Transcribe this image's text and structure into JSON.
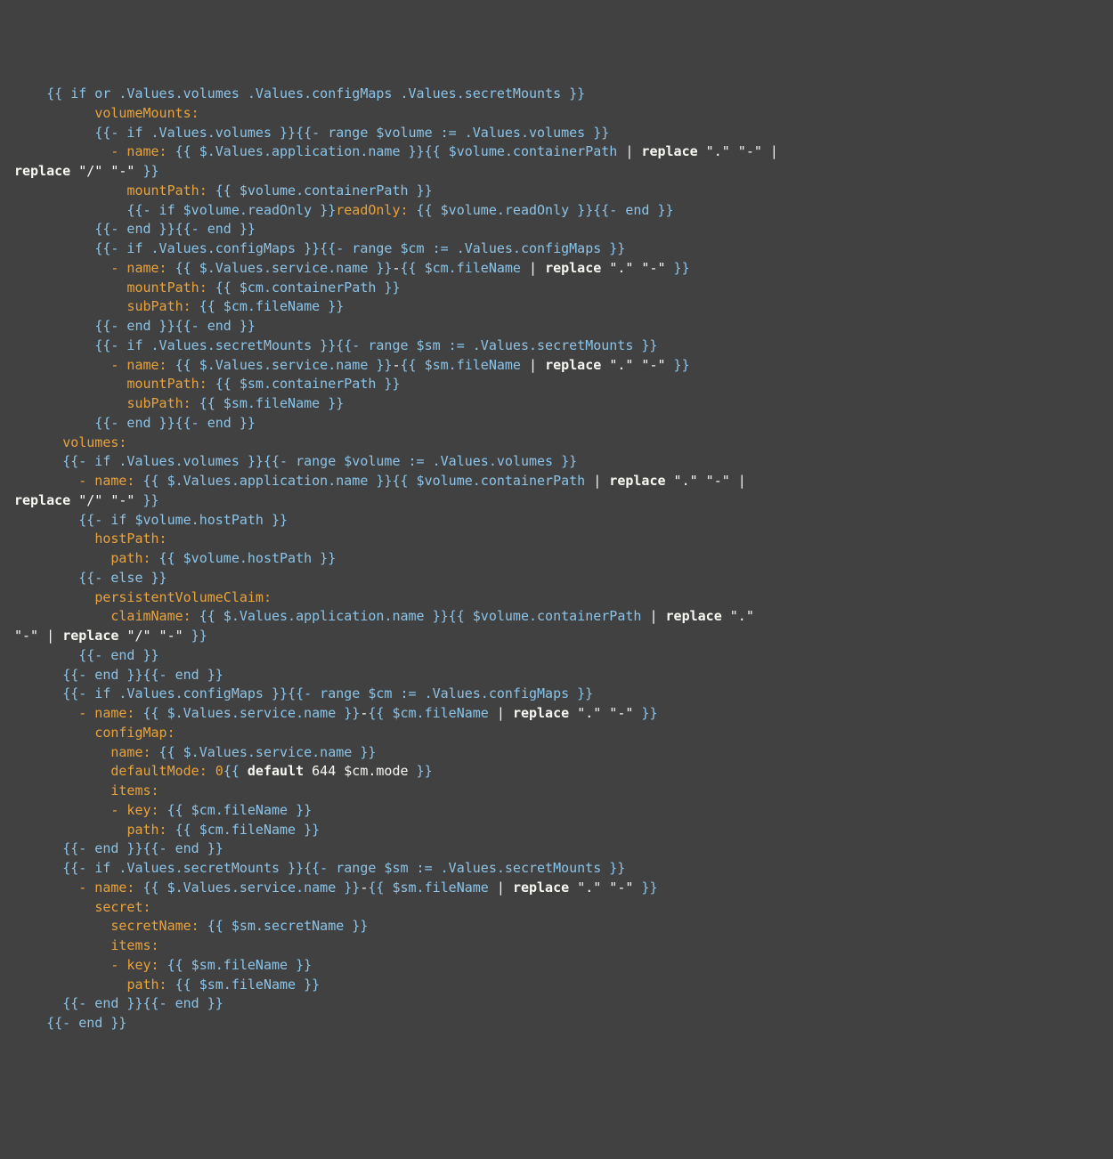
{
  "code_lines": [
    [
      {
        "cls": "op",
        "txt": "    "
      },
      {
        "cls": "tmpl",
        "txt": "{{ if or .Values.volumes .Values.configMaps .Values.secretMounts }}"
      }
    ],
    [
      {
        "cls": "op",
        "txt": "          "
      },
      {
        "cls": "key",
        "txt": "volumeMounts:"
      }
    ],
    [
      {
        "cls": "op",
        "txt": "          "
      },
      {
        "cls": "tmpl",
        "txt": "{{- if .Values.volumes }}{{- range $volume := .Values.volumes }}"
      }
    ],
    [
      {
        "cls": "op",
        "txt": "            "
      },
      {
        "cls": "key",
        "txt": "- name:"
      },
      {
        "cls": "tmpl",
        "txt": " {{ $.Values.application.name }}{{ $volume.containerPath "
      },
      {
        "cls": "op",
        "txt": "|"
      },
      {
        "cls": "op",
        "txt": " "
      },
      {
        "cls": "kw",
        "txt": "replace "
      },
      {
        "cls": "str",
        "txt": "\".\" \"-\""
      },
      {
        "cls": "op",
        "txt": " | "
      }
    ],
    [
      {
        "cls": "kw",
        "txt": "replace "
      },
      {
        "cls": "str",
        "txt": "\"/\" \"-\""
      },
      {
        "cls": "tmpl",
        "txt": " }}"
      }
    ],
    [
      {
        "cls": "op",
        "txt": "              "
      },
      {
        "cls": "key",
        "txt": "mountPath:"
      },
      {
        "cls": "tmpl",
        "txt": " {{ $volume.containerPath }}"
      }
    ],
    [
      {
        "cls": "op",
        "txt": "              "
      },
      {
        "cls": "tmpl",
        "txt": "{{- if $volume.readOnly }}"
      },
      {
        "cls": "key",
        "txt": "readOnly:"
      },
      {
        "cls": "tmpl",
        "txt": " {{ $volume.readOnly }}{{- end }}"
      }
    ],
    [
      {
        "cls": "op",
        "txt": "          "
      },
      {
        "cls": "tmpl",
        "txt": "{{- end }}{{- end }}"
      }
    ],
    [
      {
        "cls": "op",
        "txt": "          "
      },
      {
        "cls": "tmpl",
        "txt": "{{- if .Values.configMaps }}{{- range $cm := .Values.configMaps }}"
      }
    ],
    [
      {
        "cls": "op",
        "txt": "            "
      },
      {
        "cls": "key",
        "txt": "- name:"
      },
      {
        "cls": "tmpl",
        "txt": " {{ $.Values.service.name }}"
      },
      {
        "cls": "op",
        "txt": "-"
      },
      {
        "cls": "tmpl",
        "txt": "{{ $cm.fileName "
      },
      {
        "cls": "op",
        "txt": "| "
      },
      {
        "cls": "kw",
        "txt": "replace "
      },
      {
        "cls": "str",
        "txt": "\".\" \"-\""
      },
      {
        "cls": "tmpl",
        "txt": " }}"
      }
    ],
    [
      {
        "cls": "op",
        "txt": "              "
      },
      {
        "cls": "key",
        "txt": "mountPath:"
      },
      {
        "cls": "tmpl",
        "txt": " {{ $cm.containerPath }}"
      }
    ],
    [
      {
        "cls": "op",
        "txt": "              "
      },
      {
        "cls": "key",
        "txt": "subPath:"
      },
      {
        "cls": "tmpl",
        "txt": " {{ $cm.fileName }}"
      }
    ],
    [
      {
        "cls": "op",
        "txt": "          "
      },
      {
        "cls": "tmpl",
        "txt": "{{- end }}{{- end }}"
      }
    ],
    [
      {
        "cls": "op",
        "txt": "          "
      },
      {
        "cls": "tmpl",
        "txt": "{{- if .Values.secretMounts }}{{- range $sm := .Values.secretMounts }}"
      }
    ],
    [
      {
        "cls": "op",
        "txt": "            "
      },
      {
        "cls": "key",
        "txt": "- name:"
      },
      {
        "cls": "tmpl",
        "txt": " {{ $.Values.service.name }}"
      },
      {
        "cls": "op",
        "txt": "-"
      },
      {
        "cls": "tmpl",
        "txt": "{{ $sm.fileName "
      },
      {
        "cls": "op",
        "txt": "| "
      },
      {
        "cls": "kw",
        "txt": "replace "
      },
      {
        "cls": "str",
        "txt": "\".\" \"-\""
      },
      {
        "cls": "tmpl",
        "txt": " }}"
      }
    ],
    [
      {
        "cls": "op",
        "txt": "              "
      },
      {
        "cls": "key",
        "txt": "mountPath:"
      },
      {
        "cls": "tmpl",
        "txt": " {{ $sm.containerPath }}"
      }
    ],
    [
      {
        "cls": "op",
        "txt": "              "
      },
      {
        "cls": "key",
        "txt": "subPath:"
      },
      {
        "cls": "tmpl",
        "txt": " {{ $sm.fileName }}"
      }
    ],
    [
      {
        "cls": "op",
        "txt": "          "
      },
      {
        "cls": "tmpl",
        "txt": "{{- end }}{{- end }}"
      }
    ],
    [
      {
        "cls": "op",
        "txt": "      "
      },
      {
        "cls": "key",
        "txt": "volumes:"
      }
    ],
    [
      {
        "cls": "op",
        "txt": "      "
      },
      {
        "cls": "tmpl",
        "txt": "{{- if .Values.volumes }}{{- range $volume := .Values.volumes }}"
      }
    ],
    [
      {
        "cls": "op",
        "txt": "        "
      },
      {
        "cls": "key",
        "txt": "- name:"
      },
      {
        "cls": "tmpl",
        "txt": " {{ $.Values.application.name }}{{ $volume.containerPath "
      },
      {
        "cls": "op",
        "txt": "| "
      },
      {
        "cls": "kw",
        "txt": "replace "
      },
      {
        "cls": "str",
        "txt": "\".\" \"-\""
      },
      {
        "cls": "op",
        "txt": " | "
      }
    ],
    [
      {
        "cls": "kw",
        "txt": "replace "
      },
      {
        "cls": "str",
        "txt": "\"/\" \"-\""
      },
      {
        "cls": "tmpl",
        "txt": " }}"
      }
    ],
    [
      {
        "cls": "op",
        "txt": "        "
      },
      {
        "cls": "tmpl",
        "txt": "{{- if $volume.hostPath }}"
      }
    ],
    [
      {
        "cls": "op",
        "txt": "          "
      },
      {
        "cls": "key",
        "txt": "hostPath:"
      }
    ],
    [
      {
        "cls": "op",
        "txt": "            "
      },
      {
        "cls": "key",
        "txt": "path:"
      },
      {
        "cls": "tmpl",
        "txt": " {{ $volume.hostPath }}"
      }
    ],
    [
      {
        "cls": "op",
        "txt": "        "
      },
      {
        "cls": "tmpl",
        "txt": "{{- else }}"
      }
    ],
    [
      {
        "cls": "op",
        "txt": "          "
      },
      {
        "cls": "key",
        "txt": "persistentVolumeClaim:"
      }
    ],
    [
      {
        "cls": "op",
        "txt": "            "
      },
      {
        "cls": "key",
        "txt": "claimName:"
      },
      {
        "cls": "tmpl",
        "txt": " {{ $.Values.application.name }}{{ $volume.containerPath "
      },
      {
        "cls": "op",
        "txt": "| "
      },
      {
        "cls": "kw",
        "txt": "replace "
      },
      {
        "cls": "str",
        "txt": "\".\" "
      }
    ],
    [
      {
        "cls": "str",
        "txt": "\"-\""
      },
      {
        "cls": "op",
        "txt": " | "
      },
      {
        "cls": "kw",
        "txt": "replace "
      },
      {
        "cls": "str",
        "txt": "\"/\" \"-\""
      },
      {
        "cls": "tmpl",
        "txt": " }}"
      }
    ],
    [
      {
        "cls": "op",
        "txt": "        "
      },
      {
        "cls": "tmpl",
        "txt": "{{- end }}"
      }
    ],
    [
      {
        "cls": "op",
        "txt": "      "
      },
      {
        "cls": "tmpl",
        "txt": "{{- end }}{{- end }}"
      }
    ],
    [
      {
        "cls": "op",
        "txt": "      "
      },
      {
        "cls": "tmpl",
        "txt": "{{- if .Values.configMaps }}{{- range $cm := .Values.configMaps }}"
      }
    ],
    [
      {
        "cls": "op",
        "txt": "        "
      },
      {
        "cls": "key",
        "txt": "- name:"
      },
      {
        "cls": "tmpl",
        "txt": " {{ $.Values.service.name }}"
      },
      {
        "cls": "op",
        "txt": "-"
      },
      {
        "cls": "tmpl",
        "txt": "{{ $cm.fileName "
      },
      {
        "cls": "op",
        "txt": "| "
      },
      {
        "cls": "kw",
        "txt": "replace "
      },
      {
        "cls": "str",
        "txt": "\".\" \"-\""
      },
      {
        "cls": "tmpl",
        "txt": " }}"
      }
    ],
    [
      {
        "cls": "op",
        "txt": "          "
      },
      {
        "cls": "key",
        "txt": "configMap:"
      }
    ],
    [
      {
        "cls": "op",
        "txt": "            "
      },
      {
        "cls": "key",
        "txt": "name:"
      },
      {
        "cls": "tmpl",
        "txt": " {{ $.Values.service.name }}"
      }
    ],
    [
      {
        "cls": "op",
        "txt": "            "
      },
      {
        "cls": "key",
        "txt": "defaultMode: 0"
      },
      {
        "cls": "tmpl",
        "txt": "{{ "
      },
      {
        "cls": "kw",
        "txt": "default "
      },
      {
        "cls": "op",
        "txt": "644 $cm.mode"
      },
      {
        "cls": "tmpl",
        "txt": " }}"
      }
    ],
    [
      {
        "cls": "op",
        "txt": "            "
      },
      {
        "cls": "key",
        "txt": "items:"
      }
    ],
    [
      {
        "cls": "op",
        "txt": "            "
      },
      {
        "cls": "key",
        "txt": "- key:"
      },
      {
        "cls": "tmpl",
        "txt": " {{ $cm.fileName }}"
      }
    ],
    [
      {
        "cls": "op",
        "txt": "              "
      },
      {
        "cls": "key",
        "txt": "path:"
      },
      {
        "cls": "tmpl",
        "txt": " {{ $cm.fileName }}"
      }
    ],
    [
      {
        "cls": "op",
        "txt": "      "
      },
      {
        "cls": "tmpl",
        "txt": "{{- end }}{{- end }}"
      }
    ],
    [
      {
        "cls": "op",
        "txt": "      "
      },
      {
        "cls": "tmpl",
        "txt": "{{- if .Values.secretMounts }}{{- range $sm := .Values.secretMounts }}"
      }
    ],
    [
      {
        "cls": "op",
        "txt": "        "
      },
      {
        "cls": "key",
        "txt": "- name:"
      },
      {
        "cls": "tmpl",
        "txt": " {{ $.Values.service.name }}"
      },
      {
        "cls": "op",
        "txt": "-"
      },
      {
        "cls": "tmpl",
        "txt": "{{ $sm.fileName "
      },
      {
        "cls": "op",
        "txt": "| "
      },
      {
        "cls": "kw",
        "txt": "replace "
      },
      {
        "cls": "str",
        "txt": "\".\" \"-\""
      },
      {
        "cls": "tmpl",
        "txt": " }}"
      }
    ],
    [
      {
        "cls": "op",
        "txt": "          "
      },
      {
        "cls": "key",
        "txt": "secret:"
      }
    ],
    [
      {
        "cls": "op",
        "txt": "            "
      },
      {
        "cls": "key",
        "txt": "secretName:"
      },
      {
        "cls": "tmpl",
        "txt": " {{ $sm.secretName }}"
      }
    ],
    [
      {
        "cls": "op",
        "txt": "            "
      },
      {
        "cls": "key",
        "txt": "items:"
      }
    ],
    [
      {
        "cls": "op",
        "txt": "            "
      },
      {
        "cls": "key",
        "txt": "- key:"
      },
      {
        "cls": "tmpl",
        "txt": " {{ $sm.fileName }}"
      }
    ],
    [
      {
        "cls": "op",
        "txt": "              "
      },
      {
        "cls": "key",
        "txt": "path:"
      },
      {
        "cls": "tmpl",
        "txt": " {{ $sm.fileName }}"
      }
    ],
    [
      {
        "cls": "op",
        "txt": "      "
      },
      {
        "cls": "tmpl",
        "txt": "{{- end }}{{- end }}"
      }
    ],
    [
      {
        "cls": "op",
        "txt": "    "
      },
      {
        "cls": "tmpl",
        "txt": "{{- end }}"
      }
    ]
  ]
}
